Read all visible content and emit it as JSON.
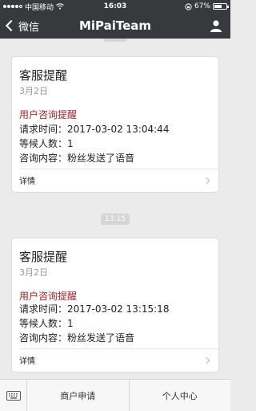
{
  "status_bar": {
    "carrier": "中国移动",
    "time": "16:03",
    "battery_text": "67%",
    "battery_level": 0.67
  },
  "nav": {
    "back_label": "微信",
    "title": "MiPaiTeam"
  },
  "messages": [
    {
      "time_label": "",
      "title": "客服提醒",
      "date": "3月2日",
      "alert": "用户咨询提醒",
      "lines": [
        "请求时间：2017-03-02 13:04:44",
        "等候人数：1",
        "咨询内容：粉丝发送了语音"
      ],
      "detail_label": "详情"
    },
    {
      "time_label": "13:15",
      "title": "客服提醒",
      "date": "3月2日",
      "alert": "用户咨询提醒",
      "lines": [
        "请求时间：2017-03-02 13:15:18",
        "等候人数：1",
        "咨询内容：粉丝发送了语音"
      ],
      "detail_label": "详情"
    }
  ],
  "bottom_menu": {
    "items": [
      "商户申请",
      "个人中心"
    ]
  },
  "colors": {
    "nav_bg": "#38393c",
    "alert": "#a0252a",
    "chat_bg": "#ebebeb"
  }
}
